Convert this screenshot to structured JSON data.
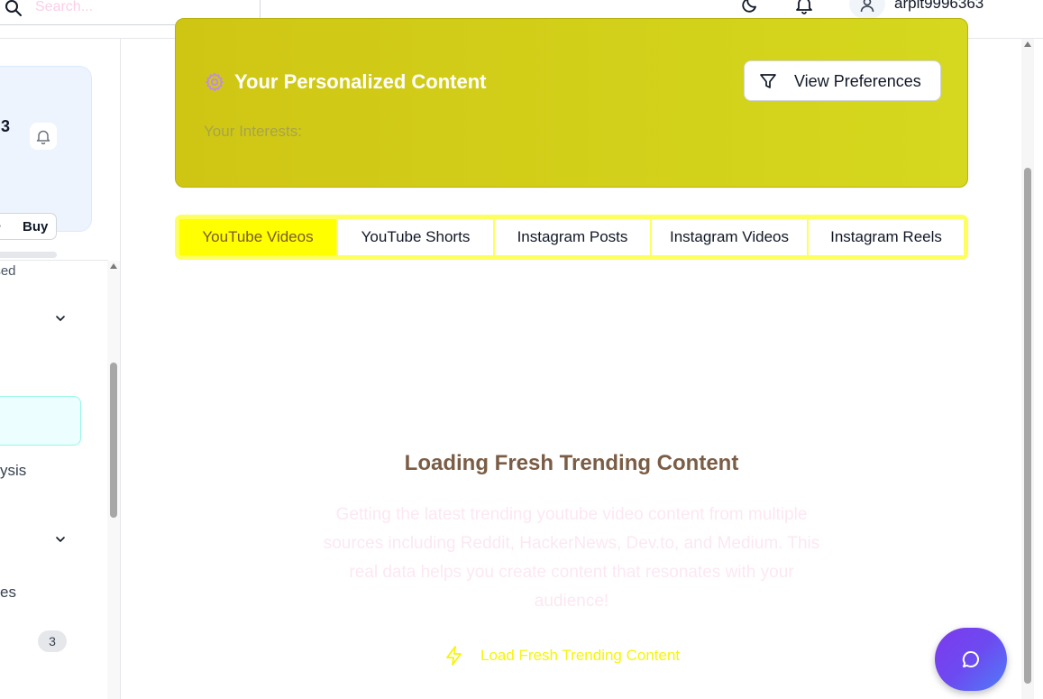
{
  "header": {
    "search_placeholder": "Search...",
    "username": "arpit9996363",
    "icons": [
      "search-icon",
      "moon-icon",
      "bell-icon",
      "user-icon"
    ]
  },
  "sidebar": {
    "credits_value": "3",
    "buy_label": "Buy",
    "used_label": "used",
    "items": [
      {
        "label": "ysis"
      },
      {
        "label": "es"
      }
    ],
    "badge_count": "3"
  },
  "banner": {
    "title": "Your Personalized Content",
    "interests_label": "Your Interests:",
    "preferences_button": "View Preferences"
  },
  "tabs": [
    {
      "label": "YouTube Videos",
      "active": true
    },
    {
      "label": "YouTube Shorts",
      "active": false
    },
    {
      "label": "Instagram Posts",
      "active": false
    },
    {
      "label": "Instagram Videos",
      "active": false
    },
    {
      "label": "Instagram Reels",
      "active": false
    }
  ],
  "loading": {
    "title": "Loading Fresh Trending Content",
    "description": "Getting the latest trending youtube video content from multiple sources including Reddit, HackerNews, Dev.to, and Medium. This real data helps you create content that resonates with your audience!",
    "button_label": "Load Fresh Trending Content"
  },
  "colors": {
    "banner": "#d3d11a",
    "tab_strip": "#fdff5e",
    "active_tab": "#ffff00",
    "loading_title": "#7b5c45",
    "chat_gradient_start": "#7c3aed",
    "chat_gradient_end": "#4f7cf8"
  }
}
